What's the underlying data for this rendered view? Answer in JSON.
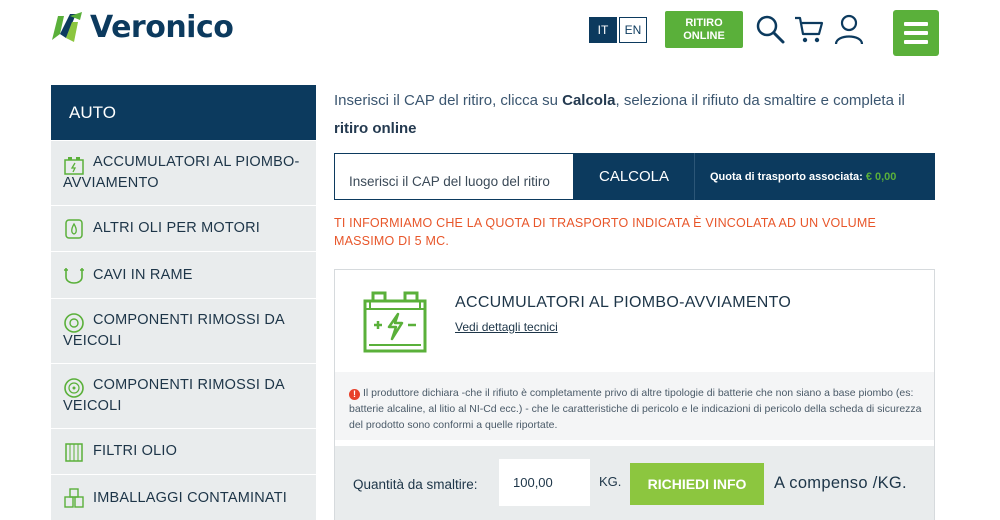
{
  "header": {
    "logo_text": "Veronico",
    "lang_it": "IT",
    "lang_en": "EN",
    "ritiro_line1": "RITIRO",
    "ritiro_line2": "ONLINE",
    "icons": [
      "search-icon",
      "cart-icon",
      "user-icon",
      "menu-icon"
    ]
  },
  "sidebar": {
    "title": "AUTO",
    "items": [
      {
        "label": "ACCUMULATORI AL PIOMBO-AVVIAMENTO",
        "icon": "battery-icon"
      },
      {
        "label": "ALTRI OLI PER MOTORI",
        "icon": "oil-drop-icon"
      },
      {
        "label": "CAVI IN RAME",
        "icon": "cable-icon"
      },
      {
        "label": "COMPONENTI RIMOSSI DA VEICOLI",
        "icon": "tire-icon"
      },
      {
        "label": "COMPONENTI RIMOSSI DA VEICOLI",
        "icon": "wheel-icon"
      },
      {
        "label": "FILTRI OLIO",
        "icon": "filter-icon"
      },
      {
        "label": "IMBALLAGGI CONTAMINATI",
        "icon": "packaging-icon"
      }
    ]
  },
  "main": {
    "intro_part1": "Inserisci il CAP del ritiro, clicca su ",
    "intro_bold1": "Calcola",
    "intro_part2": ", seleziona il rifiuto da smaltire e completa il ",
    "intro_bold2": "ritiro online",
    "cap_placeholder": "Inserisci il CAP del luogo del ritiro",
    "calcola_label": "CALCOLA",
    "quota_label": "Quota di trasporto associata:",
    "quota_value": "€ 0,00",
    "notice": "TI INFORMIAMO CHE LA QUOTA DI TRASPORTO INDICATA È VINCOLATA AD UN VOLUME MASSIMO DI 5 MC."
  },
  "product": {
    "title": "ACCUMULATORI AL PIOMBO-AVVIAMENTO",
    "link": "Vedi dettagli tecnici",
    "disclaimer": "Il produttore dichiara -che il rifiuto è completamente privo di altre tipologie di batterie che non siano a base piombo (es: batterie alcaline, al litio al NI-Cd ecc.) - che le caratteristiche di pericolo e le indicazioni di pericolo della scheda di sicurezza del prodotto sono conformi a quelle riportate.",
    "qty_label": "Quantità da smaltire:",
    "qty_value": "100,00",
    "qty_unit": "KG.",
    "request_label": "RICHIEDI INFO",
    "compenso": "A compenso /KG."
  },
  "colors": {
    "navy": "#0c3a5e",
    "green": "#5ab03a",
    "light_green": "#8cc63f",
    "notice_orange": "#e8562a"
  }
}
